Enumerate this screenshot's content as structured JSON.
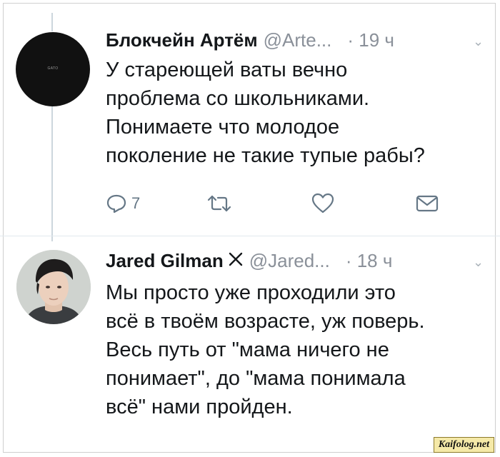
{
  "tweets": [
    {
      "author_name": "Блокчейн Артём",
      "handle": "@Arte...",
      "time": "· 19 ч",
      "avatar_label": "GATO",
      "text_lines": [
        "У стареющей ваты вечно",
        "проблема со школьниками.",
        "Понимаете что молодое",
        "поколение не такие тупые рабы?"
      ],
      "actions": {
        "reply_icon": "reply-icon",
        "reply_count": "7",
        "retweet_icon": "retweet-icon",
        "like_icon": "heart-icon",
        "dm_icon": "envelope-icon"
      }
    },
    {
      "author_name": "Jared Gilman",
      "verified_mark": "x-icon",
      "handle": "@Jared...",
      "time": "· 18 ч",
      "text_lines": [
        "Мы просто уже проходили это",
        "всё в твоём возрасте, уж поверь.",
        "Весь путь от \"мама ничего не",
        "понимает\", до \"мама понимала",
        "всё\" нами пройден."
      ]
    }
  ],
  "watermark": "Kaifolog.net",
  "colors": {
    "text": "#14171a",
    "secondary": "#8a9099",
    "icon": "#657786",
    "thread_line": "#ccd6dd"
  }
}
